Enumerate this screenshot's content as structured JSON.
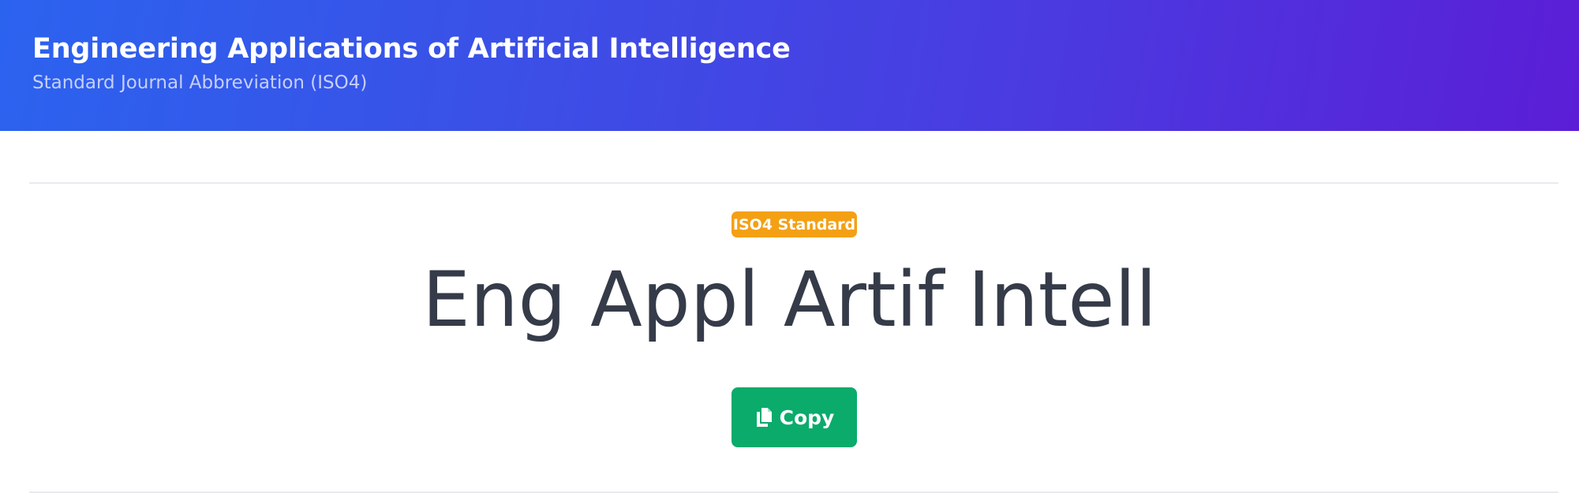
{
  "header": {
    "title": "Engineering Applications of Artificial Intelligence",
    "subtitle": "Standard Journal Abbreviation (ISO4)"
  },
  "main": {
    "badge": "ISO4 Standard",
    "abbreviation": "Eng Appl Artif Intell",
    "copy_button": {
      "label": "Copy",
      "icon": "copy-icon"
    }
  },
  "colors": {
    "header_gradient_start": "#2b63ef",
    "header_gradient_end": "#5b1ed6",
    "badge": "#f4a014",
    "copy_button": "#0aab6b",
    "abbreviation_text": "#353b48"
  }
}
